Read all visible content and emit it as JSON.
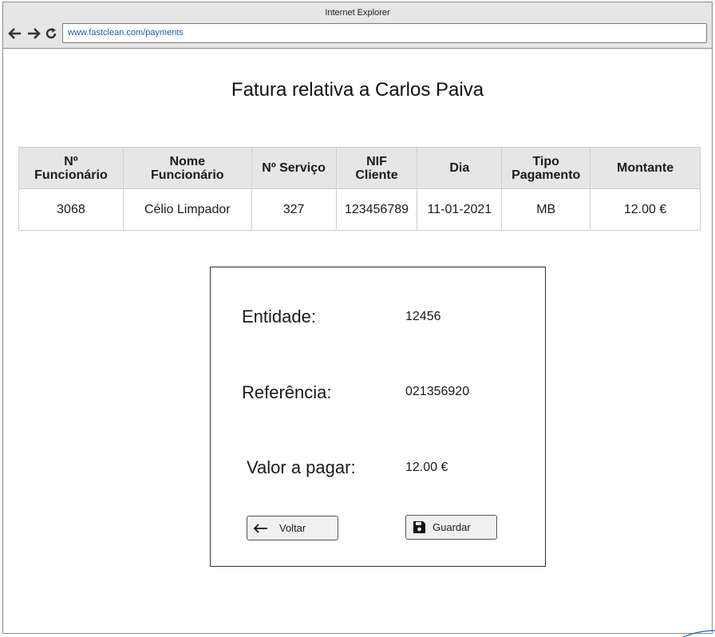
{
  "browser": {
    "title": "Internet Explorer",
    "url": "www.fastclean.com/payments"
  },
  "page": {
    "title": "Fatura relativa a Carlos Paiva"
  },
  "table": {
    "headers": [
      [
        "Nº",
        "Funcionário"
      ],
      [
        "Nome",
        "Funcionário"
      ],
      [
        "Nº Serviço"
      ],
      [
        "NIF",
        "Cliente"
      ],
      [
        "Dia"
      ],
      [
        "Tipo",
        "Pagamento"
      ],
      [
        "Montante"
      ]
    ],
    "rows": [
      [
        "3068",
        "Célio Limpador",
        "327",
        "123456789",
        "11-01-2021",
        "MB",
        "12.00 €"
      ]
    ]
  },
  "payment": {
    "entidade_label": "Entidade:",
    "entidade_value": "12456",
    "referencia_label": "Referência:",
    "referencia_value": "021356920",
    "valor_label": "Valor a pagar:",
    "valor_value": "12.00 €"
  },
  "buttons": {
    "back_label": "Voltar",
    "back_icon": "arrow-left-icon",
    "save_label": "Guardar",
    "save_icon": "floppy-disk-icon"
  },
  "colors": {
    "url_text": "#1f5fa8",
    "header_bg": "#e6e6e6",
    "titlebar_bg": "#e6e6e6"
  }
}
